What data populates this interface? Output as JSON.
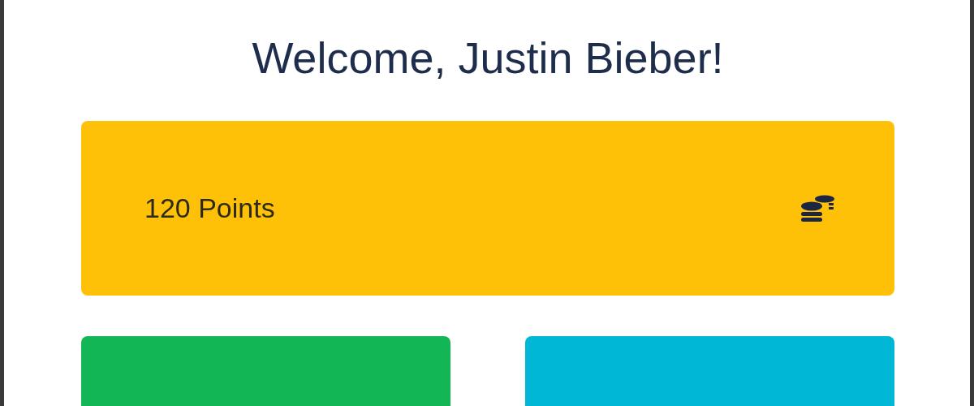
{
  "title": "Welcome, Justin Bieber!",
  "points_card": {
    "label": "120 Points"
  },
  "tiles": [
    {
      "color": "#12b655"
    },
    {
      "color": "#00b8d6"
    }
  ]
}
